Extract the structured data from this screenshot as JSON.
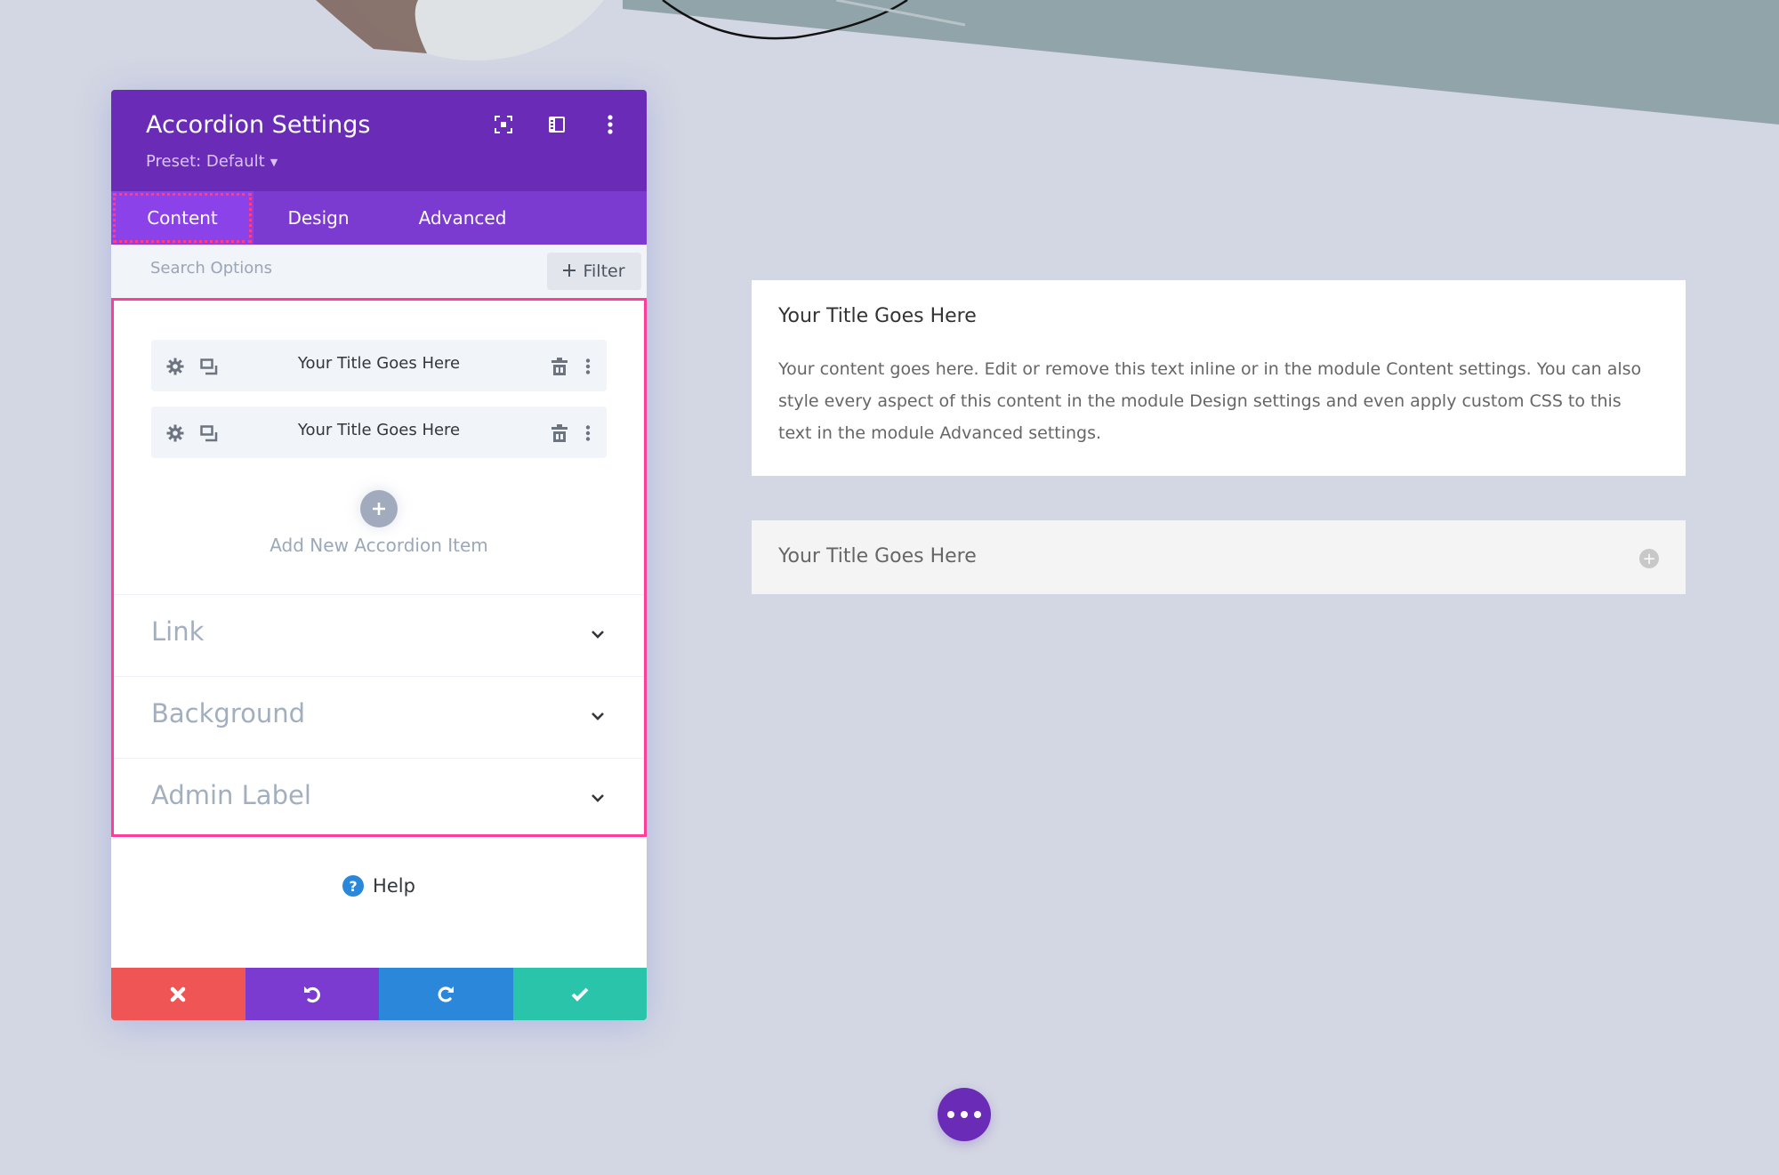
{
  "panel": {
    "title": "Accordion Settings",
    "preset_label": "Preset: Default",
    "header_icons": [
      "expand-icon",
      "split-view-icon",
      "more-vertical-icon"
    ],
    "tabs": [
      {
        "label": "Content",
        "active": true
      },
      {
        "label": "Design",
        "active": false
      },
      {
        "label": "Advanced",
        "active": false
      }
    ],
    "search": {
      "placeholder": "Search Options",
      "value": ""
    },
    "filter_label": "Filter",
    "items": [
      {
        "title": "Your Title Goes Here"
      },
      {
        "title": "Your Title Goes Here"
      }
    ],
    "add_item_label": "Add New Accordion Item",
    "sections": [
      {
        "label": "Link"
      },
      {
        "label": "Background"
      },
      {
        "label": "Admin Label"
      }
    ],
    "help_label": "Help",
    "footer_buttons": [
      {
        "name": "discard",
        "icon": "close-icon",
        "color": "#ef5555"
      },
      {
        "name": "undo",
        "icon": "undo-icon",
        "color": "#7b3ad0"
      },
      {
        "name": "redo",
        "icon": "redo-icon",
        "color": "#2b87da"
      },
      {
        "name": "save",
        "icon": "check-icon",
        "color": "#29c4a9"
      }
    ]
  },
  "preview": {
    "open_item": {
      "title": "Your Title Goes Here",
      "body": "Your content goes here. Edit or remove this text inline or in the module Content settings. You can also style every aspect of this content in the module Design settings and even apply custom CSS to this text in the module Advanced settings."
    },
    "closed_item": {
      "title": "Your Title Goes Here"
    }
  },
  "colors": {
    "header": "#6a2cb7",
    "tabs": "#7b3ad0",
    "active_tab": "#8b42e8",
    "highlight": "#ff3e9c",
    "background": "#d3d7e3"
  }
}
